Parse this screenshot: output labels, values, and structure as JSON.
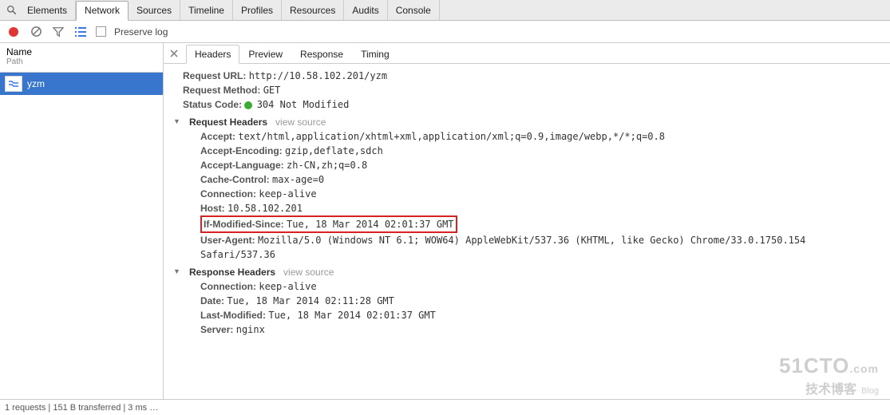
{
  "top_tabs": {
    "items": [
      "Elements",
      "Network",
      "Sources",
      "Timeline",
      "Profiles",
      "Resources",
      "Audits",
      "Console"
    ],
    "active": "Network"
  },
  "toolbar": {
    "preserve_log_label": "Preserve log"
  },
  "left": {
    "col_name": "Name",
    "col_path": "Path",
    "requests": [
      {
        "name": "yzm"
      }
    ]
  },
  "subtabs": {
    "items": [
      "Headers",
      "Preview",
      "Response",
      "Timing"
    ],
    "active": "Headers"
  },
  "general": {
    "request_url_label": "Request URL:",
    "request_url": "http://10.58.102.201/yzm",
    "request_method_label": "Request Method:",
    "request_method": "GET",
    "status_code_label": "Status Code:",
    "status_code": "304 Not Modified"
  },
  "request_headers": {
    "title": "Request Headers",
    "view_source": "view source",
    "items": {
      "Accept": "text/html,application/xhtml+xml,application/xml;q=0.9,image/webp,*/*;q=0.8",
      "Accept-Encoding": "gzip,deflate,sdch",
      "Accept-Language": "zh-CN,zh;q=0.8",
      "Cache-Control": "max-age=0",
      "Connection": "keep-alive",
      "Host": "10.58.102.201",
      "If-Modified-Since": "Tue, 18 Mar 2014 02:01:37 GMT",
      "User-Agent": "Mozilla/5.0 (Windows NT 6.1; WOW64) AppleWebKit/537.36 (KHTML, like Gecko) Chrome/33.0.1750.154 Safari/537.36"
    }
  },
  "response_headers": {
    "title": "Response Headers",
    "view_source": "view source",
    "items": {
      "Connection": "keep-alive",
      "Date": "Tue, 18 Mar 2014 02:11:28 GMT",
      "Last-Modified": "Tue, 18 Mar 2014 02:01:37 GMT",
      "Server": "nginx"
    }
  },
  "status_bar": {
    "text": "1 requests | 151 B transferred | 3 ms …"
  },
  "watermark": {
    "line1a": "51CTO",
    "line1b": ".com",
    "line2a": "技术博客",
    "line2b": "Blog"
  },
  "colors": {
    "selection": "#3876cd",
    "highlight_border": "#d62222",
    "status_green": "#3bab32",
    "record_red": "#e03535"
  }
}
